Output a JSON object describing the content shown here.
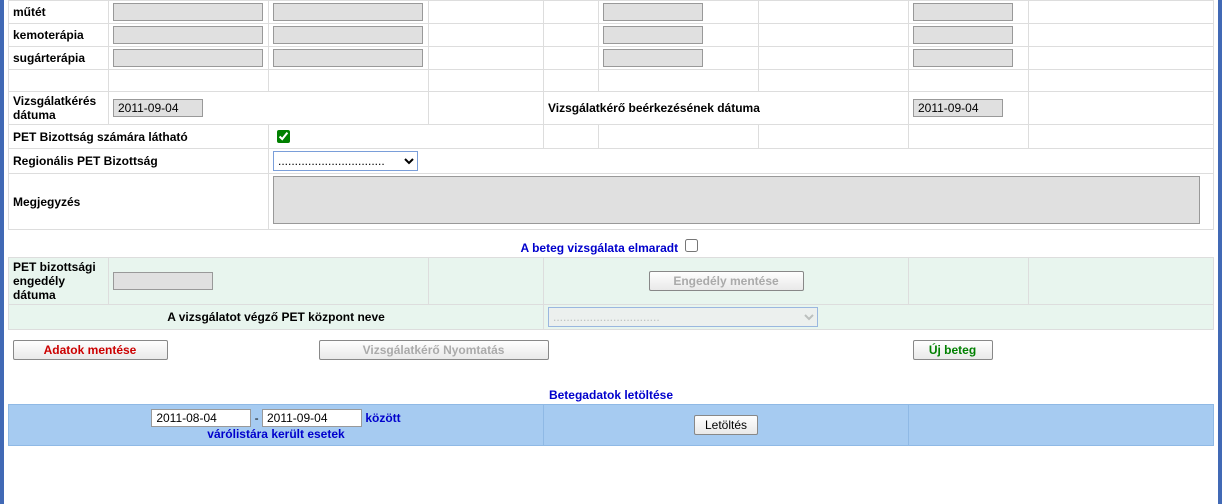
{
  "therapy": {
    "rows": [
      {
        "label": "műtét"
      },
      {
        "label": "kemoterápia"
      },
      {
        "label": "sugárterápia"
      }
    ]
  },
  "exam_request": {
    "date_label": "Vizsgálatkérés dátuma",
    "date_value": "2011-09-04",
    "received_label": "Vizsgálatkérő beérkezésének dátuma",
    "received_value": "2011-09-04"
  },
  "pet_visibility": {
    "label": "PET Bizottság számára látható",
    "checked": true
  },
  "regional": {
    "label": "Regionális PET Bizottság",
    "selected": "................................"
  },
  "note": {
    "label": "Megjegyzés",
    "value": ""
  },
  "missed": {
    "label": "A beteg vizsgálata elmaradt",
    "checked": false
  },
  "permit": {
    "date_label": "PET bizottsági engedély dátuma",
    "date_value": "",
    "save_btn": "Engedély mentése"
  },
  "performing_center": {
    "label": "A vizsgálatot végző PET központ neve",
    "selected": "................................"
  },
  "buttons": {
    "save": "Adatok mentése",
    "print": "Vizsgálatkérő Nyomtatás",
    "new": "Új beteg"
  },
  "download": {
    "title": "Betegadatok letöltése",
    "date_from": "2011-08-04",
    "date_to": "2011-09-04",
    "between": "között",
    "waiting_link": "várólistára került esetek",
    "download_btn": "Letöltés"
  }
}
